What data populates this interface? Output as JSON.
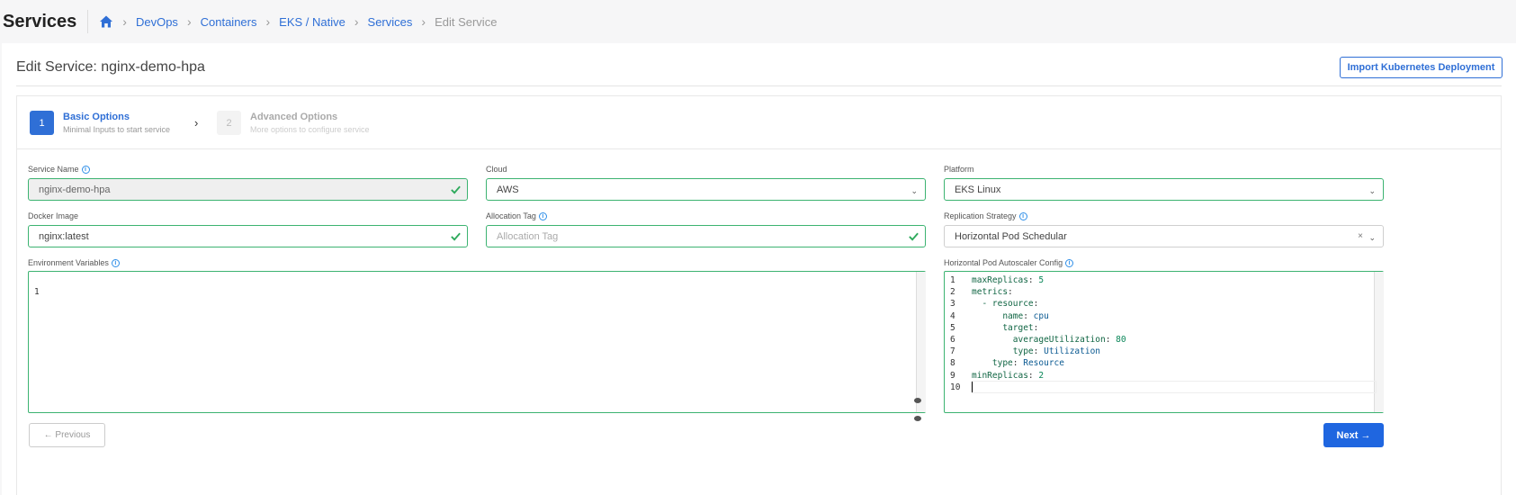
{
  "header": {
    "title": "Services",
    "breadcrumb": [
      "DevOps",
      "Containers",
      "EKS / Native",
      "Services"
    ],
    "breadcrumb_current": "Edit Service"
  },
  "main": {
    "edit_title": "Edit Service: nginx-demo-hpa",
    "import_button": "Import Kubernetes Deployment"
  },
  "stepper": {
    "steps": [
      {
        "num": "1",
        "title": "Basic Options",
        "subtitle": "Minimal Inputs to start service"
      },
      {
        "num": "2",
        "title": "Advanced Options",
        "subtitle": "More options to configure service"
      }
    ]
  },
  "form": {
    "service_name": {
      "label": "Service Name",
      "value": "nginx-demo-hpa"
    },
    "cloud": {
      "label": "Cloud",
      "value": "AWS"
    },
    "platform": {
      "label": "Platform",
      "value": "EKS Linux"
    },
    "docker_image": {
      "label": "Docker Image",
      "value": "nginx:latest"
    },
    "allocation_tag": {
      "label": "Allocation Tag",
      "placeholder": "Allocation Tag"
    },
    "replication_strategy": {
      "label": "Replication Strategy",
      "value": "Horizontal Pod Schedular"
    },
    "env_vars": {
      "label": "Environment Variables",
      "lines": [
        "1"
      ]
    },
    "hpa_config": {
      "label": "Horizontal Pod Autoscaler Config",
      "lines": [
        {
          "n": "1",
          "key": "maxReplicas",
          "val": "5",
          "indent": ""
        },
        {
          "n": "2",
          "key": "metrics",
          "val": "",
          "indent": ""
        },
        {
          "n": "3",
          "key": "- resource",
          "val": "",
          "indent": "  "
        },
        {
          "n": "4",
          "key": "name",
          "val": "cpu",
          "indent": "      "
        },
        {
          "n": "5",
          "key": "target",
          "val": "",
          "indent": "      "
        },
        {
          "n": "6",
          "key": "averageUtilization",
          "val": "80",
          "indent": "        "
        },
        {
          "n": "7",
          "key": "type",
          "val": "Utilization",
          "indent": "        "
        },
        {
          "n": "8",
          "key": "type",
          "val": "Resource",
          "indent": "    "
        },
        {
          "n": "9",
          "key": "minReplicas",
          "val": "2",
          "indent": ""
        },
        {
          "n": "10",
          "key": "",
          "val": "",
          "indent": ""
        }
      ]
    }
  },
  "footer": {
    "previous_label": "← Previous",
    "next_label": "Next →"
  },
  "colors": {
    "accent": "#2f6fd6",
    "valid_border": "#3cb371",
    "primary_button": "#1f66e0"
  }
}
